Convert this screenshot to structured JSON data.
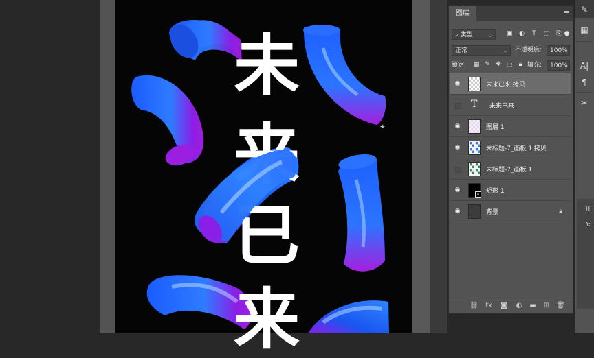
{
  "artboard": {
    "characters": [
      "未",
      "来",
      "已",
      "来"
    ]
  },
  "layers_panel": {
    "tab_label": "图层",
    "menu_icon": "hamburger-menu-icon",
    "filter": {
      "kind_label": "类型",
      "icons": [
        "image-filter-icon",
        "adjustment-filter-icon",
        "type-filter-icon",
        "shape-filter-icon",
        "smart-object-filter-icon",
        "toggle-filter-icon"
      ]
    },
    "blend_mode": "正常",
    "opacity_label": "不透明度:",
    "opacity_value": "100%",
    "lock_label": "锁定:",
    "fill_label": "填充:",
    "fill_value": "100%",
    "layers": [
      {
        "name": "未来已来 拷贝",
        "visible": true,
        "thumb": "checker",
        "selected": true
      },
      {
        "name": "未来已来",
        "visible": false,
        "type_layer": true,
        "type_glyph": "T"
      },
      {
        "name": "图层 1",
        "visible": true,
        "thumb": "pink-check"
      },
      {
        "name": "未标题-7_画板 1 拷贝",
        "visible": true,
        "thumb": "blue-pattern"
      },
      {
        "name": "未标题-7_画板 1",
        "visible": false,
        "thumb": "green-pattern"
      },
      {
        "name": "矩形 1",
        "visible": true,
        "thumb": "black",
        "mask": true
      },
      {
        "name": "背景",
        "visible": true,
        "thumb": "gray",
        "locked": true
      }
    ],
    "footer_icons": [
      "link-layers-icon",
      "fx-icon",
      "add-mask-icon",
      "adjustment-layer-icon",
      "new-group-icon",
      "new-layer-icon",
      "delete-layer-icon"
    ],
    "fx_label": "fx"
  },
  "right_strip": {
    "labels": {
      "h": "H:",
      "y": "Y:"
    }
  }
}
